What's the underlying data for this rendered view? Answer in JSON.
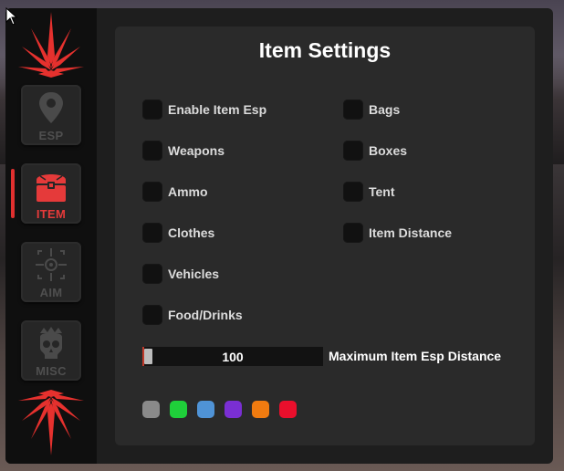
{
  "sidebar": {
    "items": [
      {
        "label": "ESP",
        "icon": "map-pin-icon"
      },
      {
        "label": "ITEM",
        "icon": "treasure-chest-icon"
      },
      {
        "label": "AIM",
        "icon": "crosshair-icon"
      },
      {
        "label": "MISC",
        "icon": "skull-icon"
      }
    ],
    "active": "ITEM",
    "decoration": "red-star-burst"
  },
  "panel": {
    "title": "Item Settings",
    "options": [
      {
        "label": "Enable Item Esp",
        "checked": false
      },
      {
        "label": "Weapons",
        "checked": false
      },
      {
        "label": "Ammo",
        "checked": false
      },
      {
        "label": "Clothes",
        "checked": false
      },
      {
        "label": "Vehicles",
        "checked": false
      },
      {
        "label": "Food/Drinks",
        "checked": false
      },
      {
        "label": "Bags",
        "checked": false
      },
      {
        "label": "Boxes",
        "checked": false
      },
      {
        "label": "Tent",
        "checked": false
      },
      {
        "label": "Item Distance",
        "checked": false
      }
    ],
    "slider": {
      "value": "100",
      "label": "Maximum Item Esp Distance"
    },
    "swatches": [
      "#8a8a8a",
      "#1fcf3a",
      "#4f93d6",
      "#7a2fd3",
      "#f07b10",
      "#ea0f2c"
    ]
  },
  "colors": {
    "accent": "#e0302f",
    "panel": "#2a2a2a",
    "sidebar": "#0f0f0f"
  }
}
